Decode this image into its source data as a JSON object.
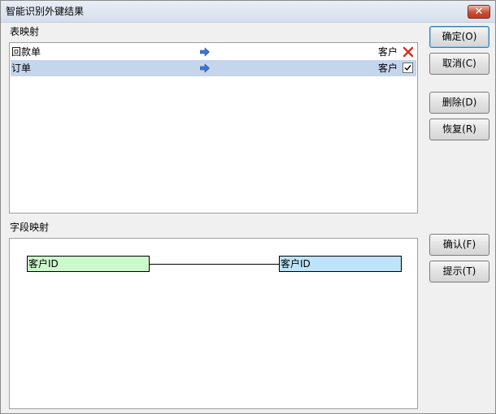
{
  "window": {
    "title": "智能识别外键结果",
    "close_label": "✕"
  },
  "table_mapping": {
    "label": "表映射",
    "rows": [
      {
        "source": "回款单",
        "target": "客户",
        "status": "rejected"
      },
      {
        "source": "订单",
        "target": "客户",
        "status": "checked",
        "selected": true
      }
    ]
  },
  "field_mapping": {
    "label": "字段映射",
    "source_field": "客户ID",
    "target_field": "客户ID",
    "colors": {
      "source_fill": "#ccf9cc",
      "target_fill": "#bde4fb"
    }
  },
  "buttons": {
    "ok": "确定(O)",
    "cancel": "取消(C)",
    "delete": "删除(D)",
    "restore": "恢复(R)",
    "confirm": "确认(F)",
    "hint": "提示(T)"
  },
  "colors": {
    "selected_row": "#c4d5ec",
    "arrow": "#3a78d6",
    "reject_mark": "#e02a1a"
  }
}
